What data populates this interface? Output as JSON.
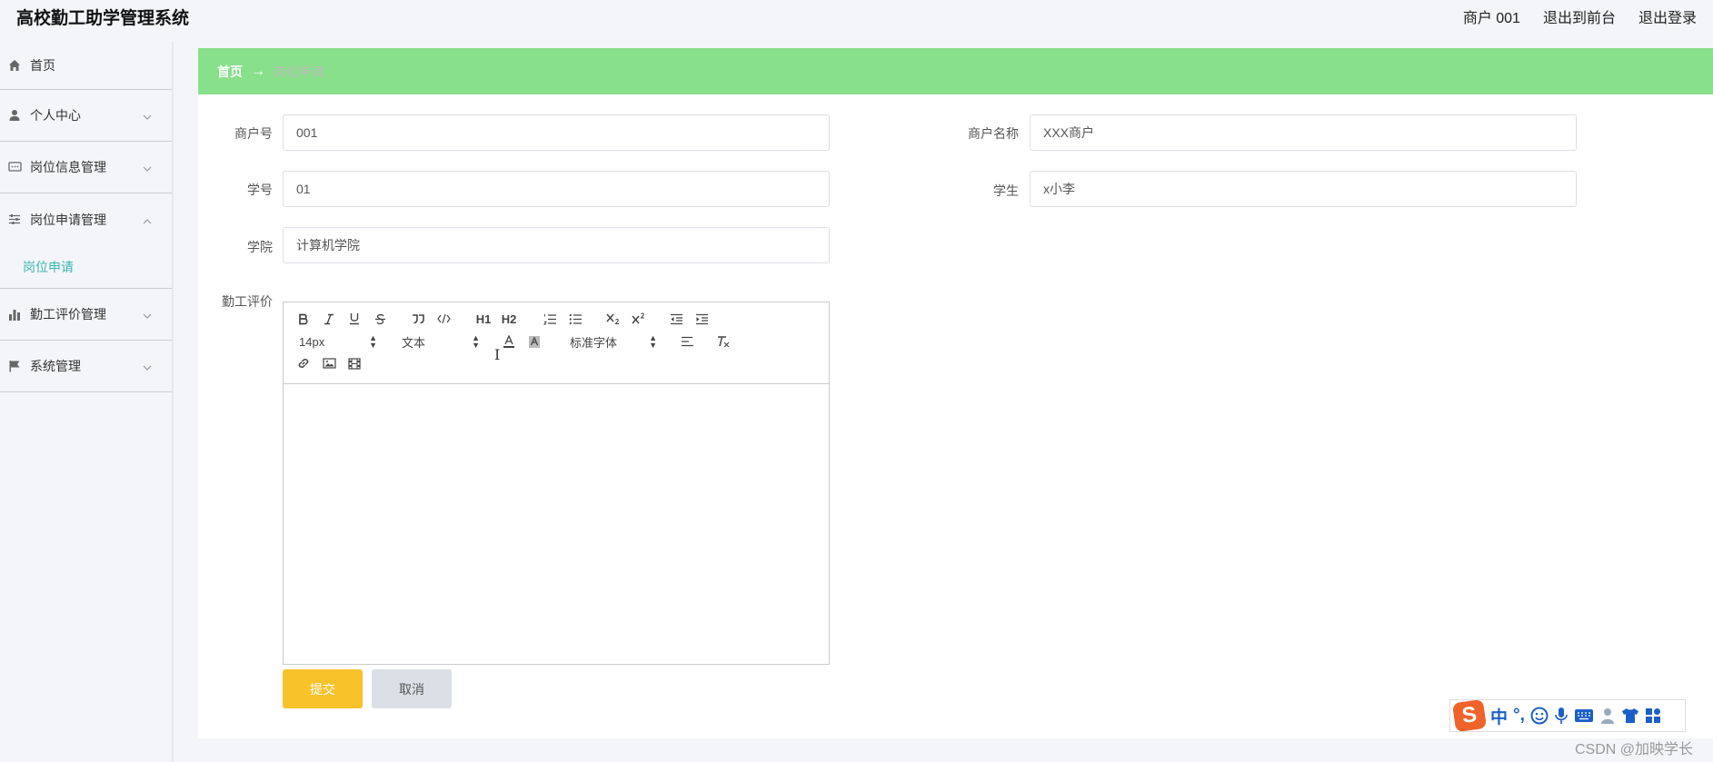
{
  "header": {
    "title": "高校勤工助学管理系统",
    "user": "商户 001",
    "to_front": "退出到前台",
    "logout": "退出登录"
  },
  "sidebar": {
    "items": [
      {
        "label": "首页",
        "icon": "home-icon"
      },
      {
        "label": "个人中心",
        "icon": "user-icon"
      },
      {
        "label": "岗位信息管理",
        "icon": "chat-icon"
      },
      {
        "label": "岗位申请管理",
        "icon": "sliders-icon",
        "submenu": [
          "岗位申请"
        ]
      },
      {
        "label": "勤工评价管理",
        "icon": "bar-chart-icon"
      },
      {
        "label": "系统管理",
        "icon": "flag-icon"
      }
    ]
  },
  "breadcrumb": {
    "home": "首页",
    "arrow": "→",
    "current": "岗位申请"
  },
  "form": {
    "merchant_no_label": "商户号",
    "merchant_no": "001",
    "merchant_name_label": "商户名称",
    "merchant_name": "XXX商户",
    "student_no_label": "学号",
    "student_no": "01",
    "student_label": "学生",
    "student": "x小李",
    "college_label": "学院",
    "college": "计算机学院",
    "evaluation_label": "勤工评价"
  },
  "editor": {
    "font_size": "14px",
    "header_select": "文本",
    "font_family": "标准字体",
    "h1": "H1",
    "h2": "H2",
    "content": ""
  },
  "buttons": {
    "submit": "提交",
    "cancel": "取消"
  },
  "ime": {
    "logo": "S",
    "lang": "中",
    "punct": "°,"
  },
  "watermark": "CSDN @加映学长",
  "colors": {
    "breadcrumb_bg": "#88e08a",
    "submit_bg": "#f8c22b",
    "submenu_active": "#3bb6b0"
  }
}
